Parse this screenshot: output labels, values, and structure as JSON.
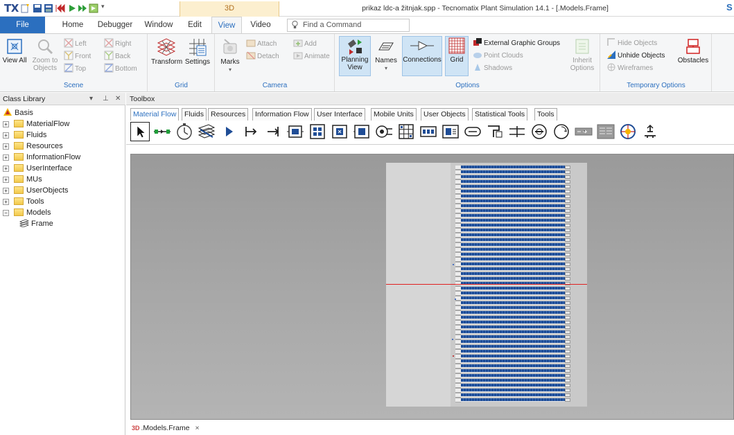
{
  "titlebar": {
    "logo": "TX",
    "context_tab": "3D",
    "window_title": "prikaz ldc-a žitnjak.spp - Tecnomatix Plant Simulation 14.1 - [.Models.Frame]",
    "right_letter": "S"
  },
  "ribbon_tabs": {
    "file": "File",
    "tabs": [
      "Home",
      "Debugger",
      "Window",
      "Edit",
      "View",
      "Video"
    ],
    "active": "View",
    "find_placeholder": "Find a Command"
  },
  "ribbon": {
    "scene": {
      "label": "Scene",
      "view_all": "View All",
      "zoom_to_objects": "Zoom to Objects",
      "left": "Left",
      "right": "Right",
      "front": "Front",
      "back": "Back",
      "top": "Top",
      "bottom": "Bottom"
    },
    "grid": {
      "label": "Grid",
      "transform": "Transform",
      "settings": "Settings"
    },
    "camera": {
      "label": "Camera",
      "marks": "Marks",
      "attach": "Attach",
      "detach": "Detach",
      "add": "Add",
      "animate": "Animate"
    },
    "options": {
      "label": "Options",
      "planning_view": "Planning View",
      "names": "Names",
      "connections": "Connections",
      "grid": "Grid",
      "external_graphic_groups": "External Graphic Groups",
      "point_clouds": "Point Clouds",
      "shadows": "Shadows",
      "inherit_options": "Inherit Options"
    },
    "temporary_options": {
      "label": "Temporary Options",
      "hide_objects": "Hide Objects",
      "unhide_objects": "Unhide Objects",
      "wireframes": "Wireframes",
      "obstacles": "Obstacles"
    }
  },
  "class_library": {
    "title": "Class Library",
    "items": [
      {
        "label": "Basis",
        "level": 0,
        "type": "root"
      },
      {
        "label": "MaterialFlow",
        "level": 1,
        "type": "folder",
        "expander": "+"
      },
      {
        "label": "Fluids",
        "level": 1,
        "type": "folder",
        "expander": "+"
      },
      {
        "label": "Resources",
        "level": 1,
        "type": "folder",
        "expander": "+"
      },
      {
        "label": "InformationFlow",
        "level": 1,
        "type": "folder",
        "expander": "+"
      },
      {
        "label": "UserInterface",
        "level": 1,
        "type": "folder",
        "expander": "+"
      },
      {
        "label": "MUs",
        "level": 1,
        "type": "folder",
        "expander": "+"
      },
      {
        "label": "UserObjects",
        "level": 1,
        "type": "folder",
        "expander": "+"
      },
      {
        "label": "Tools",
        "level": 1,
        "type": "folder",
        "expander": "+"
      },
      {
        "label": "Models",
        "level": 1,
        "type": "folder",
        "expander": "−"
      },
      {
        "label": "Frame",
        "level": 2,
        "type": "frame"
      }
    ]
  },
  "toolbox": {
    "title": "Toolbox",
    "tabs": [
      "Material Flow",
      "Fluids",
      "Resources",
      "Information Flow",
      "User Interface",
      "Mobile Units",
      "User Objects",
      "Statistical Tools",
      "Tools"
    ],
    "active_tab": "Material Flow",
    "tools": [
      "pointer-icon",
      "connector-icon",
      "event-controller-icon",
      "frame-icon",
      "interface-icon",
      "source-icon",
      "drain-icon",
      "single-proc-icon",
      "parallel-proc-icon",
      "assembly-icon",
      "dismantle-icon",
      "shift-icon",
      "store-icon",
      "cycle-icon",
      "generator-icon",
      "buffer-icon",
      "sorter-icon",
      "line-icon",
      "angular-converter-icon",
      "turntable-icon",
      "turnplate-icon",
      "track-icon",
      "two-lane-track-icon",
      "transfer-station-icon",
      "flow-control-icon"
    ]
  },
  "document_tab": {
    "prefix": "3D",
    "label": ".Models.Frame",
    "close": "×"
  },
  "colors": {
    "accent": "#2b6fbf",
    "rack_blue": "#1f4d96",
    "red_line": "#e02020"
  }
}
